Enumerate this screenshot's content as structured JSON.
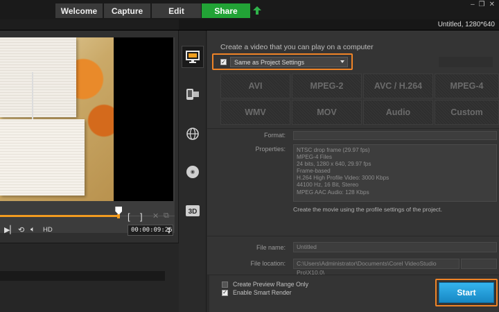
{
  "tabs": [
    {
      "label": "Welcome",
      "active": false
    },
    {
      "label": "Capture",
      "active": false
    },
    {
      "label": "Edit",
      "active": false
    },
    {
      "label": "Share",
      "active": true
    }
  ],
  "window_controls": [
    "–",
    "❐",
    "✕"
  ],
  "project_info": "Untitled, 1280*640",
  "player": {
    "timecode": "00:00:09:26",
    "hd_label": "HD",
    "mark_in": "[",
    "mark_out": "]",
    "playhead_fraction": 0.68
  },
  "share_categories": [
    {
      "name": "computer",
      "icon": "monitor-icon",
      "selected": true
    },
    {
      "name": "device",
      "icon": "device-icon",
      "selected": false
    },
    {
      "name": "web",
      "icon": "globe-icon",
      "selected": false
    },
    {
      "name": "disc",
      "icon": "disc-icon",
      "selected": false
    },
    {
      "name": "3d",
      "icon": "3d-icon",
      "label": "3D",
      "selected": false
    }
  ],
  "content": {
    "heading": "Create a video that you can play on a computer",
    "profile_checked": true,
    "profile_select": "Same as Project Settings",
    "formats": [
      "AVI",
      "MPEG-2",
      "AVC / H.264",
      "MPEG-4",
      "WMV",
      "MOV",
      "Audio",
      "Custom"
    ],
    "format_label": "Format:",
    "properties_label": "Properties:",
    "properties": [
      "NTSC drop frame (29.97 fps)",
      "MPEG-4 Files",
      "24 bits, 1280 x 640, 29.97 fps",
      "Frame-based",
      "H.264 High Profile Video: 3000 Kbps",
      "44100 Hz, 16 Bit, Stereo",
      "MPEG AAC Audio: 128 Kbps"
    ],
    "description": "Create the movie using the profile settings of the project.",
    "file_name_label": "File name:",
    "file_name": "Untitled",
    "file_location_label": "File location:",
    "file_location": "C:\\Users\\Administrator\\Documents\\Corel VideoStudio Pro\\X10.0\\",
    "options": [
      {
        "label": "Create Preview Range Only",
        "checked": false
      },
      {
        "label": "Enable Smart Render",
        "checked": true
      }
    ],
    "start_label": "Start"
  },
  "colors": {
    "active_tab": "#22a336",
    "highlight_box": "#f08427",
    "start_button": "#2aa3dd",
    "scrubber": "#f29b20"
  }
}
